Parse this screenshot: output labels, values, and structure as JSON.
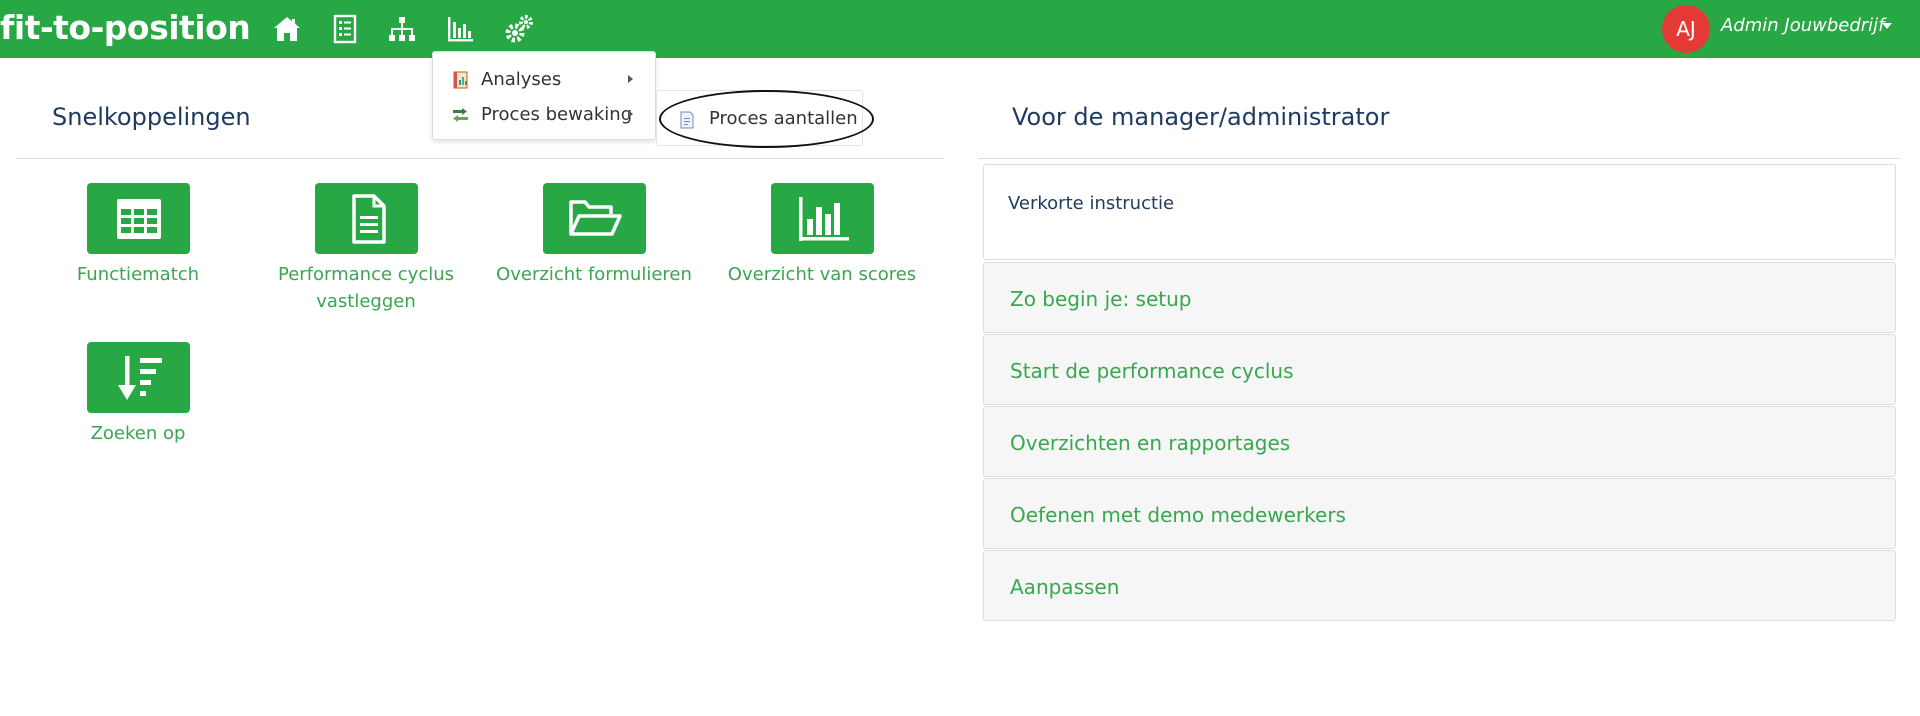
{
  "header": {
    "brand": "fit-to-position",
    "nav_icons": [
      "home-icon",
      "checklist-icon",
      "org-chart-icon",
      "bar-chart-icon",
      "gears-icon"
    ],
    "user_initials": "AJ",
    "user_name": "Admin Jouwbedrijf",
    "brand_color": "#28a745",
    "avatar_color": "#e53935"
  },
  "analysis_menu": {
    "items": [
      {
        "label": "Analyses",
        "icon": "report-icon"
      },
      {
        "label": "Proces bewaking",
        "icon": "process-icon"
      }
    ],
    "submenu": {
      "label": "Proces aantallen",
      "icon": "document-icon"
    }
  },
  "left": {
    "title": "Snelkoppelingen",
    "tiles": [
      {
        "label": "Functiematch",
        "icon": "table-icon"
      },
      {
        "label": "Performance cyclus vastleggen",
        "icon": "document-icon"
      },
      {
        "label": "Overzicht formulieren",
        "icon": "folder-open-icon"
      },
      {
        "label": "Overzicht van scores",
        "icon": "bar-chart-icon"
      },
      {
        "label": "Zoeken op",
        "icon": "sort-descending-icon"
      }
    ]
  },
  "right": {
    "title": "Voor de manager/administrator",
    "instruction": "Verkorte instructie",
    "accordion": [
      "Zo begin je: setup",
      "Start de performance cyclus",
      "Overzichten en rapportages",
      "Oefenen met demo medewerkers",
      "Aanpassen"
    ]
  }
}
